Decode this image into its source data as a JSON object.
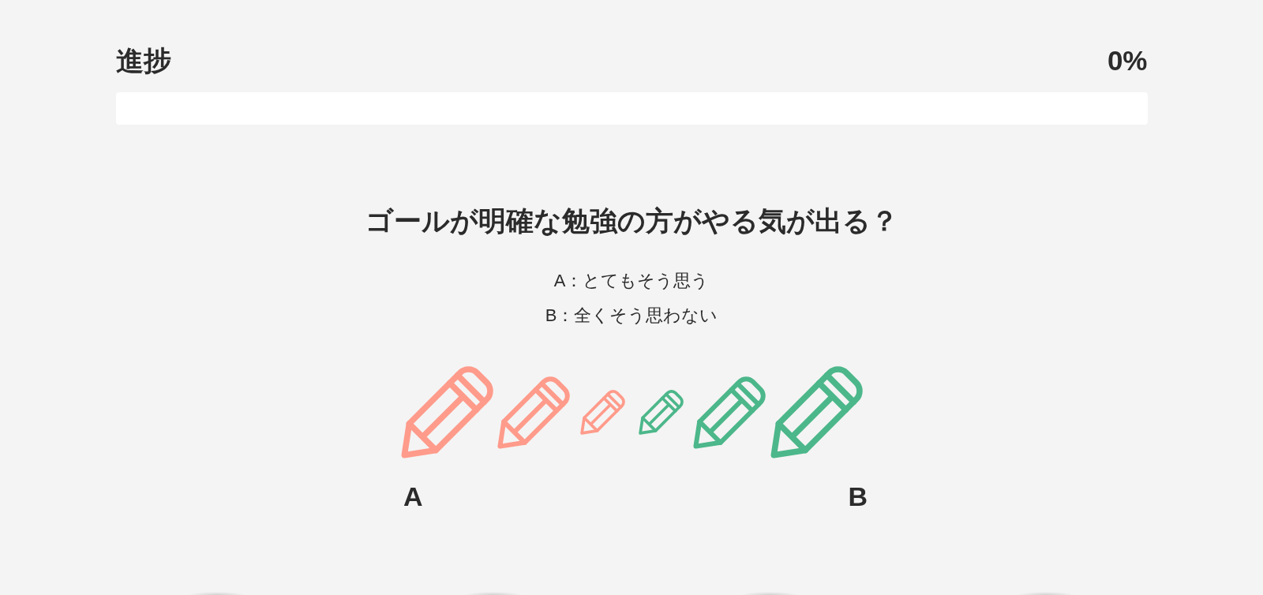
{
  "progress": {
    "label": "進捗",
    "reading": "0%",
    "level": 0
  },
  "question": {
    "title": "ゴールが明確な勉強の方がやる気が出る？",
    "legend": [
      "A：とてもそう思う",
      "B：全くそう思わない"
    ],
    "options": [
      {
        "kind": "large",
        "color": "#ff9b8b",
        "selected": false
      },
      {
        "kind": "medium",
        "color": "#ff9b8b",
        "selected": false
      },
      {
        "kind": "small",
        "color": "#ff9b8b",
        "selected": false
      },
      {
        "kind": "small",
        "color": "#4cb78a",
        "selected": false
      },
      {
        "kind": "medium",
        "color": "#4cb78a",
        "selected": false
      },
      {
        "kind": "large",
        "color": "#4cb78a",
        "selected": false
      }
    ],
    "scale_labels": [
      "A",
      "B"
    ]
  }
}
